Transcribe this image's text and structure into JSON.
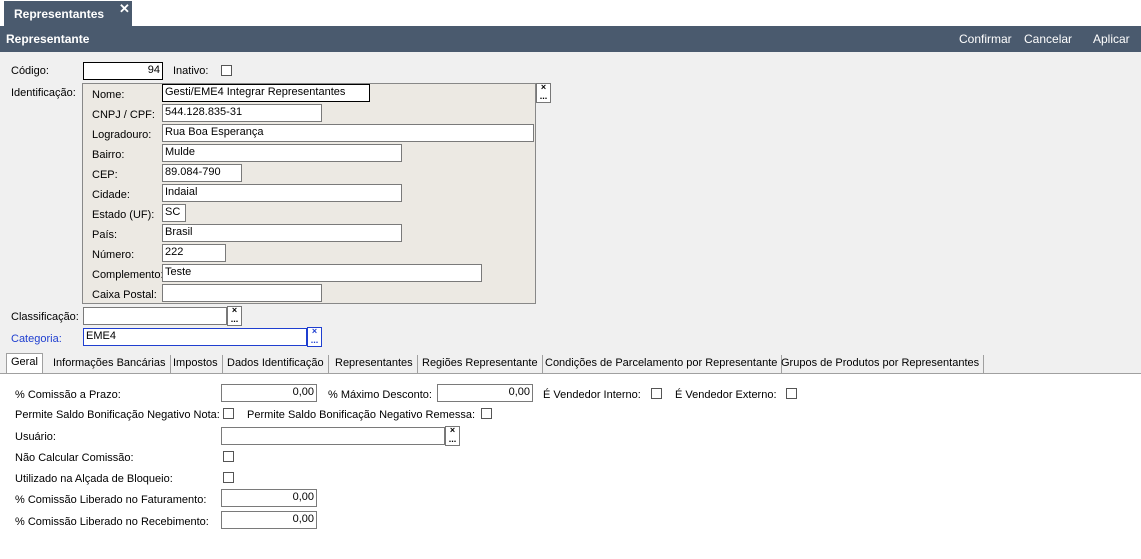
{
  "doc_tab": {
    "title": "Representantes",
    "close": "✕"
  },
  "header": {
    "title": "Representante",
    "confirm": "Confirmar",
    "cancel": "Cancelar",
    "apply": "Aplicar"
  },
  "form": {
    "codigo_label": "Código:",
    "codigo_value": "94",
    "inativo_label": "Inativo:",
    "identificacao_label": "Identificação:",
    "classificacao_label": "Classificação:",
    "classificacao_value": "",
    "categoria_label": "Categoria:",
    "categoria_value": "EME4"
  },
  "identificacao": {
    "nome_label": "Nome:",
    "nome_value": "Gesti/EME4 Integrar Representantes",
    "cnpj_label": "CNPJ / CPF:",
    "cnpj_value": "544.128.835-31",
    "logradouro_label": "Logradouro:",
    "logradouro_value": "Rua Boa Esperança",
    "bairro_label": "Bairro:",
    "bairro_value": "Mulde",
    "cep_label": "CEP:",
    "cep_value": "89.084-790",
    "cidade_label": "Cidade:",
    "cidade_value": "Indaial",
    "estado_label": "Estado (UF):",
    "estado_value": "SC",
    "pais_label": "País:",
    "pais_value": "Brasil",
    "numero_label": "Número:",
    "numero_value": "222",
    "complemento_label": "Complemento:",
    "complemento_value": "Teste",
    "caixa_label": "Caixa Postal:",
    "caixa_value": ""
  },
  "lookup_glyphs": {
    "clear": "×",
    "browse": "..."
  },
  "tabs": [
    "Geral",
    "Informações Bancárias",
    "Impostos",
    "Dados Identificação",
    "Representantes",
    "Regiões Representante",
    "Condições de Parcelamento por Representante",
    "Grupos de Produtos por Representantes"
  ],
  "geral": {
    "comissao_prazo_label": "% Comissão a Prazo:",
    "comissao_prazo_value": "0,00",
    "max_desconto_label": "% Máximo Desconto:",
    "max_desconto_value": "0,00",
    "vendedor_interno_label": "É Vendedor Interno:",
    "vendedor_externo_label": "É Vendedor Externo:",
    "saldo_nota_label": "Permite Saldo Bonificação Negativo Nota:",
    "saldo_remessa_label": "Permite Saldo Bonificação Negativo Remessa:",
    "usuario_label": "Usuário:",
    "usuario_value": "",
    "nao_calcular_label": "Não Calcular Comissão:",
    "alcada_label": "Utilizado na Alçada de Bloqueio:",
    "liberado_fat_label": "% Comissão Liberado no Faturamento:",
    "liberado_fat_value": "0,00",
    "liberado_rec_label": "% Comissão Liberado no Recebimento:",
    "liberado_rec_value": "0,00"
  },
  "colors": {
    "header_bg": "#4a5a6e",
    "accent_blue": "#1f3fd0"
  }
}
